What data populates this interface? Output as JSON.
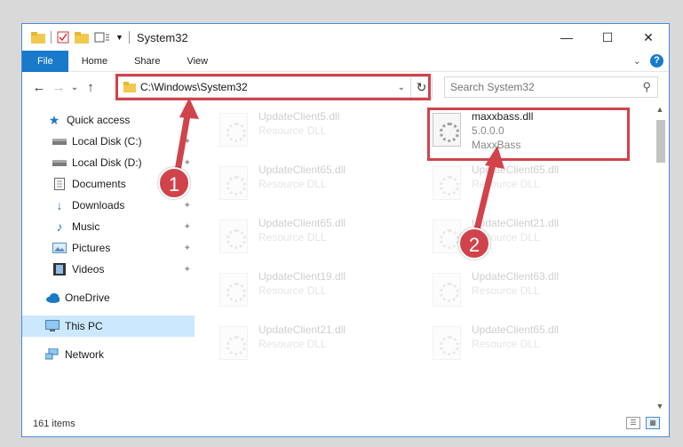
{
  "window": {
    "title": "System32",
    "controls": {
      "minimize": "—",
      "maximize": "☐",
      "close": "✕"
    }
  },
  "ribbon": {
    "tabs": [
      "File",
      "Home",
      "Share",
      "View"
    ],
    "expand_glyph": "⌄",
    "help_glyph": "?"
  },
  "nav": {
    "back": "←",
    "forward": "→",
    "recent": "⌄",
    "up": "↑",
    "address": "C:\\Windows\\System32",
    "address_dropdown": "⌄",
    "refresh": "↻",
    "search_placeholder": "Search System32",
    "search_glyph": "⚲"
  },
  "sidebar": {
    "items": [
      {
        "label": "Quick access",
        "icon": "star-icon",
        "pinned": false
      },
      {
        "label": "Local Disk (C:)",
        "icon": "drive-icon",
        "pinned": true
      },
      {
        "label": "Local Disk (D:)",
        "icon": "drive-icon",
        "pinned": true
      },
      {
        "label": "Documents",
        "icon": "documents-icon",
        "pinned": true
      },
      {
        "label": "Downloads",
        "icon": "download-icon",
        "pinned": true
      },
      {
        "label": "Music",
        "icon": "music-icon",
        "pinned": true
      },
      {
        "label": "Pictures",
        "icon": "pictures-icon",
        "pinned": true
      },
      {
        "label": "Videos",
        "icon": "videos-icon",
        "pinned": true
      },
      {
        "label": "OneDrive",
        "icon": "cloud-icon",
        "pinned": false
      },
      {
        "label": "This PC",
        "icon": "computer-icon",
        "pinned": false,
        "selected": true
      },
      {
        "label": "Network",
        "icon": "network-icon",
        "pinned": false
      }
    ],
    "pin_glyph": "📌"
  },
  "files": {
    "left": [
      {
        "name": "UpdateClient5.dll",
        "type": "Resource DLL"
      },
      {
        "name": "UpdateClient65.dll",
        "type": "Resource DLL"
      },
      {
        "name": "UpdateClient65.dll",
        "type": "Resource DLL"
      },
      {
        "name": "UpdateClient19.dll",
        "type": "Resource DLL"
      },
      {
        "name": "UpdateClient21.dll",
        "type": "Resource DLL"
      }
    ],
    "right": [
      {
        "name": "maxxbass.dll",
        "version": "5.0.0.0",
        "product": "MaxxBass"
      },
      {
        "name": "UpdateClient65.dll",
        "type": "Resource DLL"
      },
      {
        "name": "UpdateClient21.dll",
        "type": "Resource DLL"
      },
      {
        "name": "UpdateClient63.dll",
        "type": "Resource DLL"
      },
      {
        "name": "UpdateClient65.dll",
        "type": "Resource DLL"
      }
    ]
  },
  "status": {
    "item_count": "161 items"
  },
  "annotations": {
    "step1": "1",
    "step2": "2",
    "color": "#d1434b"
  },
  "colors": {
    "accent": "#1979ca",
    "selected": "#cce8ff"
  }
}
